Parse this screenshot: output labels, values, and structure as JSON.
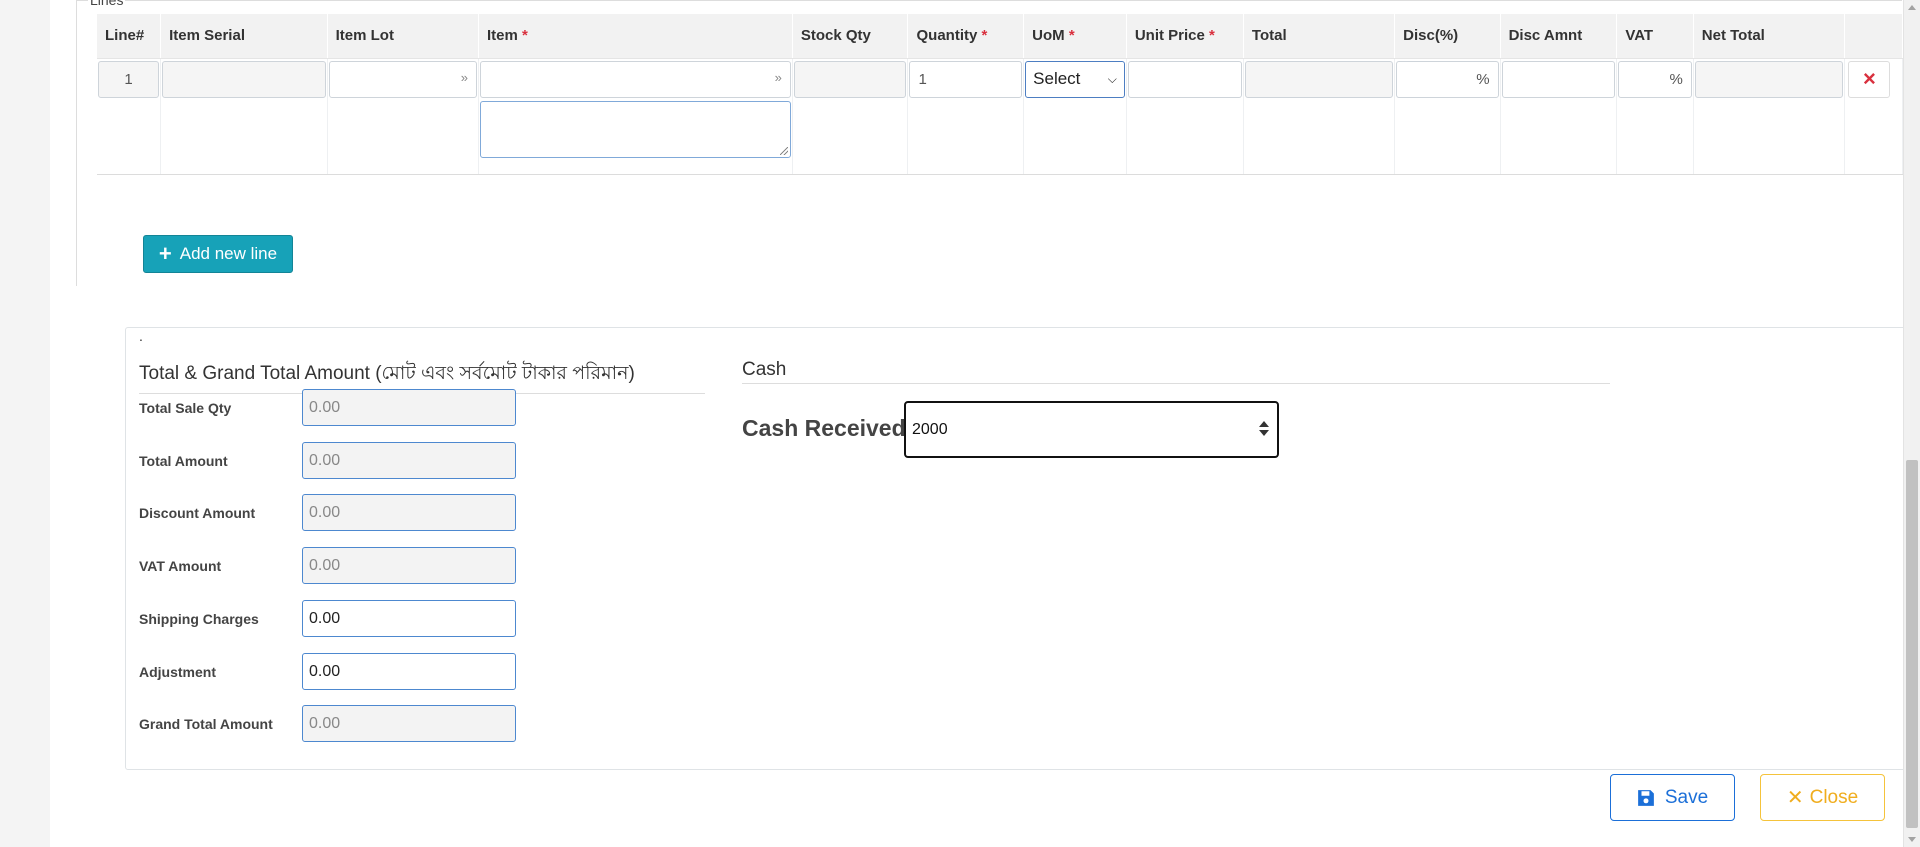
{
  "lines": {
    "legend": "Lines",
    "columns": [
      {
        "label": "Line#",
        "required": false
      },
      {
        "label": "Item Serial",
        "required": false
      },
      {
        "label": "Item Lot",
        "required": false
      },
      {
        "label": "Item",
        "required": true
      },
      {
        "label": "Stock Qty",
        "required": false
      },
      {
        "label": "Quantity",
        "required": true
      },
      {
        "label": "UoM",
        "required": true
      },
      {
        "label": "Unit Price",
        "required": true
      },
      {
        "label": "Total",
        "required": false
      },
      {
        "label": "Disc(%)",
        "required": false
      },
      {
        "label": "Disc Amnt",
        "required": false
      },
      {
        "label": "VAT",
        "required": false
      },
      {
        "label": "Net Total",
        "required": false
      }
    ],
    "rows": [
      {
        "line_no": "1",
        "item_serial": "",
        "item_lot": "",
        "item": "",
        "stock_qty": "",
        "quantity": "1",
        "uom": "Select",
        "unit_price": "",
        "total": "",
        "disc_percent_suffix": "%",
        "disc_amount": "",
        "vat_suffix": "%",
        "net_total": ""
      }
    ],
    "required_mark": "*",
    "delete_icon": "×",
    "add_line_label": "Add new line"
  },
  "totals": {
    "dot": ".",
    "title": "Total & Grand Total Amount (মোট এবং সর্বমোট টাকার পরিমান)",
    "fields": {
      "total_sale_qty": {
        "label": "Total Sale Qty",
        "value": "0.00"
      },
      "total_amount": {
        "label": "Total Amount",
        "value": "0.00"
      },
      "discount_amount": {
        "label": "Discount Amount",
        "value": "0.00"
      },
      "vat_amount": {
        "label": "VAT Amount",
        "value": "0.00"
      },
      "shipping_charges": {
        "label": "Shipping Charges",
        "value": "0.00"
      },
      "adjustment": {
        "label": "Adjustment",
        "value": "0.00"
      },
      "grand_total_amount": {
        "label": "Grand Total Amount",
        "value": "0.00"
      }
    }
  },
  "cash": {
    "title": "Cash",
    "received_label": "Cash Received",
    "received_value": "2000"
  },
  "actions": {
    "save_label": "Save",
    "close_label": "Close"
  },
  "colors": {
    "accent_info": "#17a2b8",
    "primary": "#1b6fd8",
    "warning": "#f0ad1e",
    "danger": "#d9303e"
  }
}
